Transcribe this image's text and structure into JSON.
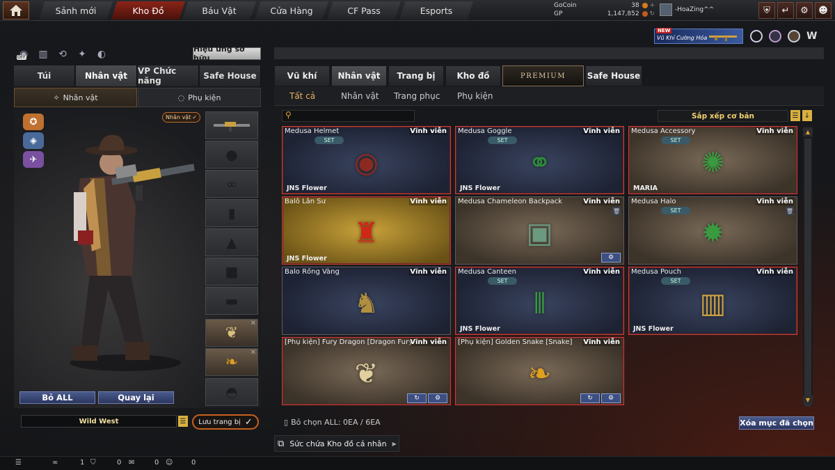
{
  "topnav": {
    "tabs": [
      "Sảnh mới",
      "Kho Đồ",
      "Báu Vật",
      "Cửa Hàng",
      "CF Pass",
      "Esports"
    ],
    "active_tab": "Kho Đồ"
  },
  "currency": {
    "gocoin_label": "GoCoin",
    "gocoin_value": "38",
    "gp_label": "GP",
    "gp_value": "1,147,852"
  },
  "user": {
    "name": "-HoaZing^^"
  },
  "promo": {
    "badge": "NEW",
    "text": "Vũ Khí Cường Hóa"
  },
  "left_panel": {
    "off_label": "OFF",
    "effect_button": "Hiệu ứng sở hữu",
    "tabs": [
      "Túi",
      "Nhân vật",
      "VP Chức năng",
      "Safe House"
    ],
    "active_tab": "Nhân vật",
    "subtabs": [
      "Nhân vật",
      "Phụ kiện"
    ],
    "character_badge": "Nhân vật",
    "buttons": {
      "remove_all": "Bỏ ALL",
      "back": "Quay lại"
    },
    "preset_name": "Wild West",
    "save_button": "Lưu trang bị"
  },
  "right_panel": {
    "tabs": [
      "Vũ khí",
      "Nhân vật",
      "Trang bị",
      "Kho đồ",
      "PREMIUM",
      "Safe House"
    ],
    "active_tab": "Nhân vật",
    "subtabs": [
      "Tất cả",
      "Nhân vật",
      "Trang phục",
      "Phụ kiện"
    ],
    "active_subtab": "Tất cả",
    "search_placeholder": "",
    "sort_label": "Sắp xếp cơ bản",
    "set_label": "SET",
    "items": [
      {
        "name": "Medusa Helmet",
        "duration": "Vĩnh viễn",
        "set": true,
        "owner": "JNS Flower",
        "bg": "dark",
        "selected": true,
        "icon": "helmet-icon"
      },
      {
        "name": "Medusa Goggle",
        "duration": "Vĩnh viễn",
        "set": true,
        "owner": "JNS Flower",
        "bg": "dark",
        "selected": true,
        "icon": "goggle-icon"
      },
      {
        "name": "Medusa Accessory",
        "duration": "Vĩnh viễn",
        "set": true,
        "owner": "MARIA",
        "bg": "sand",
        "selected": true,
        "icon": "accessory-icon"
      },
      {
        "name": "Balô Lân Sư",
        "duration": "Vĩnh viễn",
        "set": false,
        "owner": "JNS Flower",
        "bg": "gold",
        "selected": true,
        "icon": "lion-backpack-icon"
      },
      {
        "name": "Medusa Chameleon Backpack",
        "duration": "Vĩnh viễn",
        "set": false,
        "owner": "",
        "bg": "sand",
        "selected": false,
        "icon": "backpack-icon"
      },
      {
        "name": "Medusa Halo",
        "duration": "Vĩnh viễn",
        "set": true,
        "owner": "",
        "bg": "sand",
        "selected": false,
        "icon": "halo-icon"
      },
      {
        "name": "Balo Rồng Vàng",
        "duration": "Vĩnh viễn",
        "set": false,
        "owner": "",
        "bg": "dark",
        "selected": false,
        "icon": "dragon-backpack-icon"
      },
      {
        "name": "Medusa Canteen",
        "duration": "Vĩnh viễn",
        "set": true,
        "owner": "JNS Flower",
        "bg": "dark",
        "selected": true,
        "icon": "canteen-icon"
      },
      {
        "name": "Medusa Pouch",
        "duration": "Vĩnh viễn",
        "set": true,
        "owner": "JNS Flower",
        "bg": "dark",
        "selected": true,
        "icon": "pouch-icon"
      },
      {
        "name": "[Phụ kiện] Fury Dragon [Dragon Fury]",
        "duration": "Vĩnh viễn",
        "set": false,
        "owner": "",
        "bg": "sand",
        "selected": true,
        "icon": "dragon-charm-icon"
      },
      {
        "name": "[Phụ kiện] Golden Snake [Snake]",
        "duration": "Vĩnh viễn",
        "set": false,
        "owner": "",
        "bg": "sand",
        "selected": true,
        "icon": "snake-charm-icon"
      }
    ],
    "selection_info": "Bỏ chọn ALL: 0EA / 6EA",
    "clear_button": "Xóa mục đã chọn",
    "capacity_label": "Sức chứa Kho đồ cá nhân"
  },
  "bottom_bar": {
    "counts": [
      "1",
      "0",
      "0",
      "0"
    ]
  },
  "colors": {
    "accent_red": "#c8403a",
    "accent_gold": "#e8b060",
    "button_blue": "#3c4e82"
  }
}
